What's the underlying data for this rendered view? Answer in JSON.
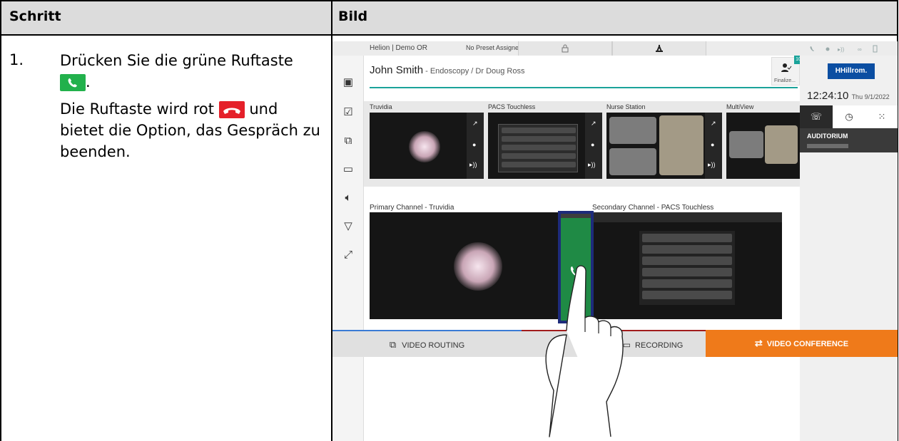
{
  "table": {
    "header_left": "Schritt",
    "header_right": "Bild",
    "step_number": "1.",
    "step_line1": "Drücken Sie die grüne Ruftaste",
    "step_line1_end": ".",
    "step_line2_a": "Die Ruftaste wird rot",
    "step_line2_b": "und",
    "step_line2_c": "bietet die Option, das Gespräch zu beenden."
  },
  "ui": {
    "room": "Helion | Demo OR",
    "preset": "No Preset Assigned",
    "patient_name": "John Smith",
    "patient_detail": " - Endoscopy / Dr Doug Ross",
    "finalize_label": "Finalize...",
    "finalize_badge": "10",
    "brand": "Hillrom.",
    "brand_mark": "H",
    "time": "12:24:10",
    "date": "Thu 9/1/2022",
    "auditorium": "AUDITORIUM",
    "thumbs": [
      "Truvidia",
      "PACS Touchless",
      "Nurse Station",
      "MultiView"
    ],
    "primary_channel": "Primary Channel - Truvidia",
    "secondary_channel": "Secondary Channel - PACS Touchless",
    "bottom": {
      "routing": "VIDEO ROUTING",
      "recording": "RECORDING",
      "conference": "VIDEO CONFERENCE"
    }
  },
  "colors": {
    "call_green": "#22b14c",
    "call_red": "#e5202a",
    "accent_teal": "#1aa39a",
    "conference_orange": "#ef7a1a",
    "hillrom_blue": "#0b4ea2"
  }
}
